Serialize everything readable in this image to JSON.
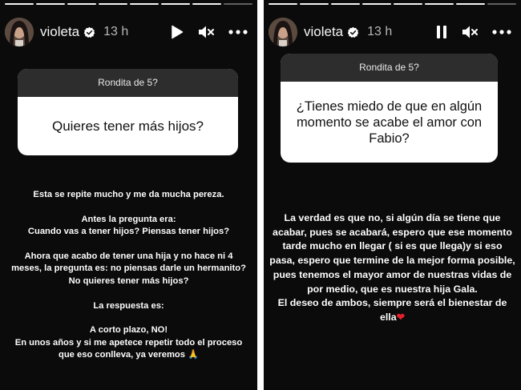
{
  "stories": [
    {
      "user": {
        "name": "violeta",
        "verified": true,
        "time": "13 h"
      },
      "controls": {
        "play_pause": "play",
        "mute_icon": "speaker-muted-icon",
        "more_icon": "more-icon"
      },
      "progress": {
        "total": 8,
        "viewed": 7
      },
      "question": {
        "header": "Rondita de 5?",
        "text": "Quieres tener más hijos?"
      },
      "answer": {
        "p1": "Esta se repite mucho y me da mucha pereza.",
        "p2a": "Antes la pregunta era:",
        "p2b": "Cuando vas a tener hijos? Piensas tener hijos?",
        "p3": "Ahora que acabo de tener una hija y no hace ni 4 meses, la pregunta es: no piensas darle un hermanito? No quieres tener más hijos?",
        "p4": "La respuesta es:",
        "p5a": "A corto plazo, NO!",
        "p5b": "En unos años y si me apetece repetir todo el proceso que eso conlleva, ya veremos 🙏"
      }
    },
    {
      "user": {
        "name": "violeta",
        "verified": true,
        "time": "13 h"
      },
      "controls": {
        "play_pause": "pause",
        "mute_icon": "speaker-muted-icon",
        "more_icon": "more-icon"
      },
      "progress": {
        "total": 8,
        "viewed": 7
      },
      "question": {
        "header": "Rondita de 5?",
        "text": "¿Tienes miedo de que en algún momento se acabe el amor con Fabio?"
      },
      "answer": {
        "p1": "La verdad es que no, si algún día se tiene que acabar, pues se acabará, espero que ese momento tarde mucho en llegar ( si es que llega)y si eso pasa, espero que termine de la mejor forma posible, pues tenemos el mayor amor de nuestras vidas de por medio, que es nuestra hija Gala.",
        "p2": "El deseo de ambos, siempre será el bienestar de ella",
        "heart": "❤"
      }
    }
  ],
  "colors": {
    "background": "#0b0b0b",
    "question_header_bg": "#2d2d2d",
    "question_body_bg": "#ffffff",
    "verified_blue": "#ffffff",
    "heart": "#e0202a"
  }
}
